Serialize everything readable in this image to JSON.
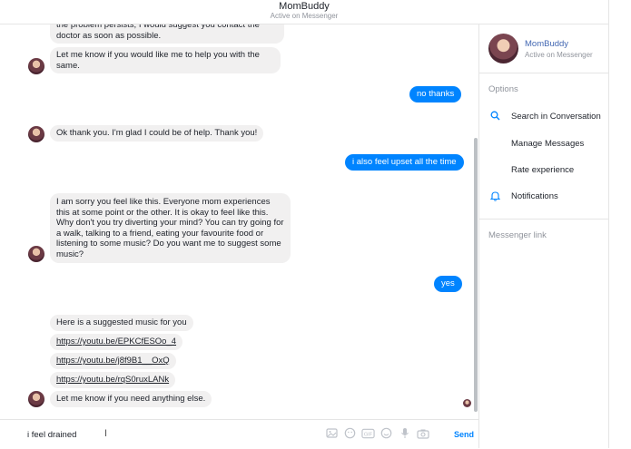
{
  "header": {
    "title": "MomBuddy",
    "status": "Active on Messenger"
  },
  "messages": {
    "m1": "the problem persists, I would suggest you contact the doctor as soon as possible.",
    "m2": "Let me know if you would like me to help you with the same.",
    "u1": "no thanks",
    "m3": "Ok thank you. I'm glad I could be of help. Thank you!",
    "u2": "i also feel upset all the time",
    "m4": "I am sorry you feel like this. Everyone mom experiences this at some point or the other. It is okay to feel like this. Why don't you try diverting your mind? You can try going for a walk, talking to a friend, eating your favourite food or listening to some music? Do you want me to suggest some music?",
    "u3": "yes",
    "m5": "Here is a suggested music for you",
    "link1": "https://youtu.be/EPKCfESOo_4",
    "link2": "https://youtu.be/j8f9B1__OxQ",
    "link3": "https://youtu.be/rqS0ruxLANk",
    "m6": "Let me know if you need anything else."
  },
  "composer": {
    "text": "i feel drained",
    "send_label": "Send"
  },
  "sidebar": {
    "name": "MomBuddy",
    "status": "Active on Messenger",
    "options_header": "Options",
    "options": [
      {
        "label": "Search in Conversation",
        "icon": "search-icon"
      },
      {
        "label": "Manage Messages",
        "icon": ""
      },
      {
        "label": "Rate experience",
        "icon": ""
      },
      {
        "label": "Notifications",
        "icon": "bell-icon"
      }
    ],
    "messenger_link": "Messenger link"
  },
  "colors": {
    "accent": "#0084ff",
    "incoming_bubble": "#f1f0f0",
    "link": "#4267b2"
  }
}
